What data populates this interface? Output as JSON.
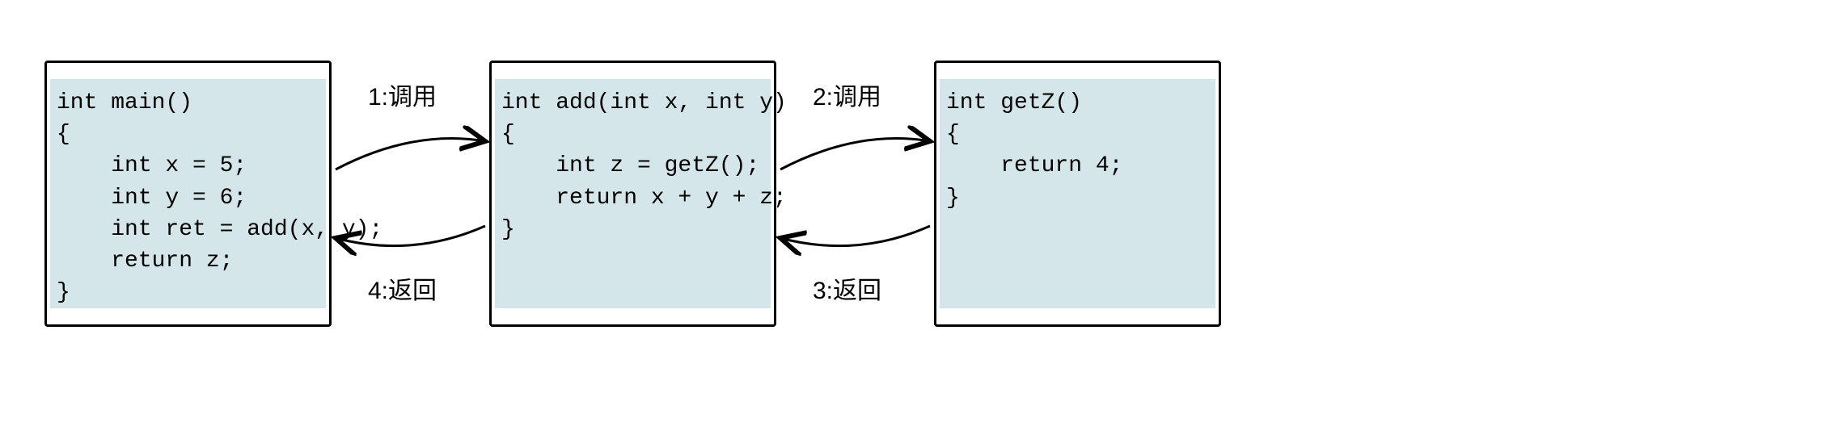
{
  "boxes": {
    "main": {
      "code": "int main()\n{\n    int x = 5;\n    int y = 6;\n    int ret = add(x, y);\n    return z;\n}"
    },
    "add": {
      "code": "int add(int x, int y)\n{\n    int z = getZ();\n    return x + y + z;\n}"
    },
    "getZ": {
      "code": "int getZ()\n{\n    return 4;\n}"
    }
  },
  "arrows": {
    "a1": {
      "label": "1:调用"
    },
    "a2": {
      "label": "2:调用"
    },
    "a3": {
      "label": "3:返回"
    },
    "a4": {
      "label": "4:返回"
    }
  }
}
